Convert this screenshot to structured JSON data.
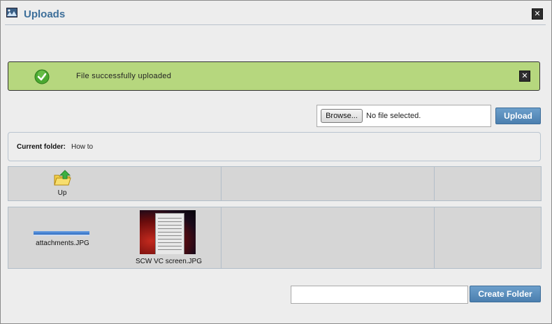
{
  "window": {
    "title": "Uploads",
    "close_label": "✕",
    "icon": "image-gallery-icon"
  },
  "notification": {
    "message": "File successfully uploaded",
    "icon": "check-circle-icon",
    "close_label": "✕",
    "status_color": "#b6d77e"
  },
  "upload": {
    "browse_label": "Browse...",
    "file_status": "No file selected.",
    "upload_label": "Upload"
  },
  "folder": {
    "label": "Current folder:",
    "value": "How to"
  },
  "grid": {
    "up_label": "Up",
    "up_icon": "folder-up-icon",
    "files": [
      {
        "name": "attachments.JPG"
      },
      {
        "name": "SCW VC screen.JPG"
      }
    ]
  },
  "create_folder": {
    "input_value": "",
    "button_label": "Create Folder"
  },
  "colors": {
    "accent": "#4b7faf",
    "title": "#3d6f9a"
  }
}
